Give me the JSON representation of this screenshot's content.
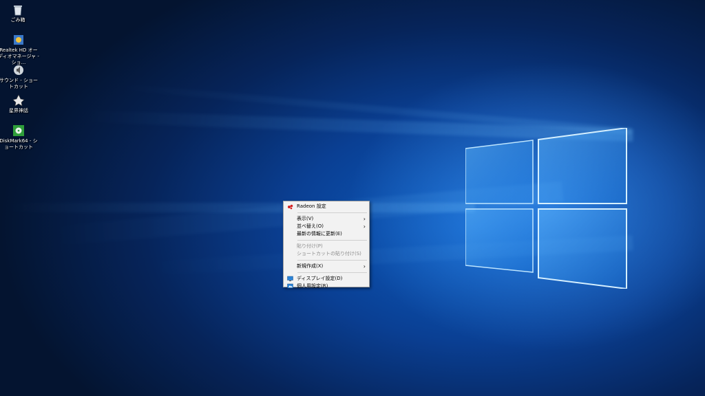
{
  "desktop": {
    "icons": [
      {
        "label": "ごみ箱",
        "icon": "recycle-bin-icon"
      },
      {
        "label": "Realtek HD オーディオマネージャ - ショ...",
        "icon": "audio-manager-icon"
      },
      {
        "label": "サウンド - ショートカット",
        "icon": "sound-shortcut-icon"
      },
      {
        "label": "星界神話",
        "icon": "game-shortcut-icon"
      },
      {
        "label": "DiskMark64 - ショートカット",
        "icon": "diskmark-icon"
      }
    ]
  },
  "context_menu": {
    "items": [
      {
        "label": "Radeon 設定",
        "icon": "radeon-icon"
      },
      {
        "label": "表示(V)",
        "submenu": true
      },
      {
        "label": "並べ替え(O)",
        "submenu": true
      },
      {
        "label": "最新の情報に更新(E)"
      },
      {
        "label": "貼り付け(P)",
        "disabled": true
      },
      {
        "label": "ショートカットの貼り付け(S)",
        "disabled": true
      },
      {
        "label": "新規作成(X)",
        "submenu": true
      },
      {
        "label": "ディスプレイ設定(D)",
        "icon": "display-settings-icon"
      },
      {
        "label": "個人用設定(R)",
        "icon": "personalize-icon"
      }
    ]
  },
  "colors": {
    "accent": "#0078d7",
    "menu_bg": "#f2f2f2",
    "disabled_text": "#8a8a8a"
  }
}
